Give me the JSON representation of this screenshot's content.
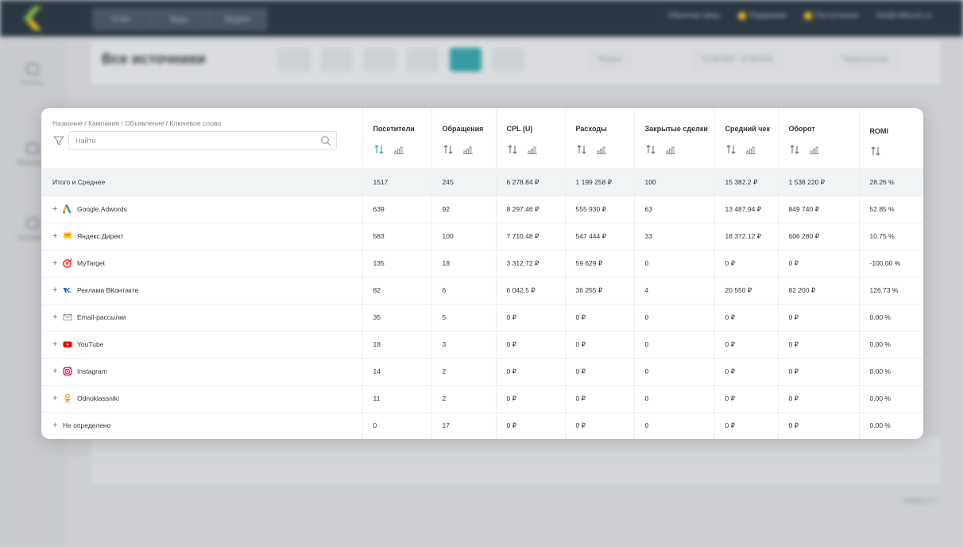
{
  "background": {
    "topnav": [
      "Отчёт",
      "Виды",
      "Бюджет"
    ],
    "topright": [
      "Обратная связь",
      "Подарками",
      "Поступления",
      "info@calltouch.ru"
    ],
    "sidebar": [
      "Отчёты",
      "Маркетинг",
      "Настройки"
    ],
    "page_title": "Все источники",
    "pills": [
      "Модели",
      "01.08.2022 – 31.08.2022",
      "Представления"
    ],
    "pager": "‹ Назад  1  2  ›"
  },
  "modal": {
    "breadcrumb": "Название / Кампания / Объявление / Ключевое слово",
    "search_placeholder": "Найти",
    "columns": [
      "Посетители",
      "Обращения",
      "CPL (U)",
      "Расходы",
      "Закрытые сделки",
      "Средний чек",
      "Оборот",
      "ROMI"
    ],
    "total": {
      "label": "Итого и Среднее",
      "values": [
        "1517",
        "245",
        "6 278.84 ₽",
        "1 199 258 ₽",
        "100",
        "15 382.2 ₽",
        "1 538 220 ₽",
        "28.26 %"
      ]
    },
    "rows": [
      {
        "icon": "google-ads-icon",
        "label": "Google.Adwords",
        "values": [
          "639",
          "92",
          "8 297.46 ₽",
          "555 930 ₽",
          "63",
          "13 487.94 ₽",
          "849 740 ₽",
          "52.85 %"
        ]
      },
      {
        "icon": "yandex-direct-icon",
        "label": "Яндекс.Директ",
        "values": [
          "583",
          "100",
          "7 710.48 ₽",
          "547 444 ₽",
          "33",
          "18 372.12 ₽",
          "606 280 ₽",
          "10.75 %"
        ]
      },
      {
        "icon": "mytarget-icon",
        "label": "MyTarget",
        "values": [
          "135",
          "18",
          "3 312.72 ₽",
          "59 629 ₽",
          "0",
          "0 ₽",
          "0 ₽",
          "-100.00 %"
        ]
      },
      {
        "icon": "vk-icon",
        "label": "Реклама ВКонтакте",
        "values": [
          "82",
          "6",
          "6 042.5 ₽",
          "36 255 ₽",
          "4",
          "20 550 ₽",
          "82 200 ₽",
          "126.73 %"
        ]
      },
      {
        "icon": "email-icon",
        "label": "Email-рассылки",
        "values": [
          "35",
          "5",
          "0 ₽",
          "0 ₽",
          "0",
          "0 ₽",
          "0 ₽",
          "0.00 %"
        ]
      },
      {
        "icon": "youtube-icon",
        "label": "YouTube",
        "values": [
          "18",
          "3",
          "0 ₽",
          "0 ₽",
          "0",
          "0 ₽",
          "0 ₽",
          "0.00 %"
        ]
      },
      {
        "icon": "instagram-icon",
        "label": "Instagram",
        "values": [
          "14",
          "2",
          "0 ₽",
          "0 ₽",
          "0",
          "0 ₽",
          "0 ₽",
          "0.00 %"
        ]
      },
      {
        "icon": "odnoklassniki-icon",
        "label": "Odnoklassniki",
        "values": [
          "11",
          "2",
          "0 ₽",
          "0 ₽",
          "0",
          "0 ₽",
          "0 ₽",
          "0.00 %"
        ]
      },
      {
        "icon": "none",
        "label": "Не определено",
        "values": [
          "0",
          "17",
          "0 ₽",
          "0 ₽",
          "0",
          "0 ₽",
          "0 ₽",
          "0.00 %"
        ]
      }
    ]
  },
  "colors": {
    "accent_teal": "#3aa3a8",
    "header_dark": "#2c3a45"
  }
}
